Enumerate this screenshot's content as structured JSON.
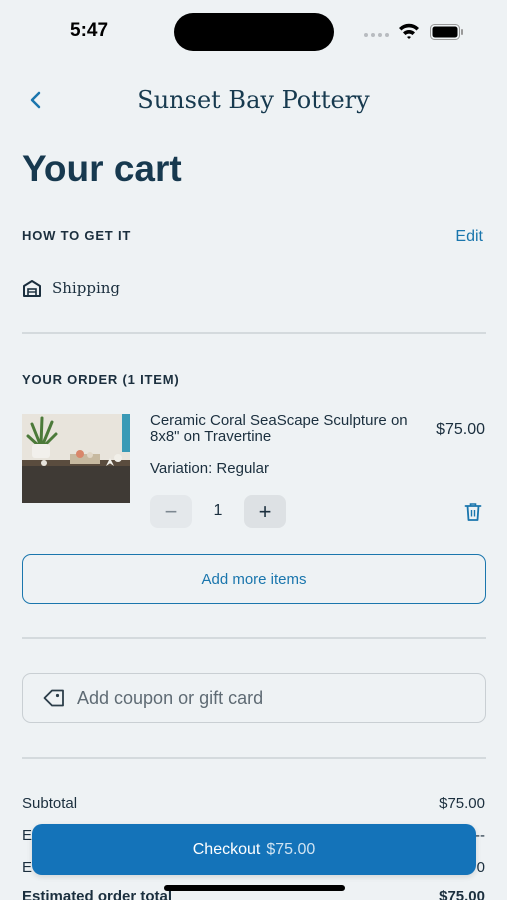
{
  "status_bar": {
    "time": "5:47"
  },
  "header": {
    "store_name": "Sunset Bay Pottery",
    "page_title": "Your cart"
  },
  "fulfillment": {
    "section_label": "HOW TO GET IT",
    "edit_label": "Edit",
    "method": "Shipping"
  },
  "order": {
    "section_label": "YOUR ORDER (1 ITEM)",
    "items": [
      {
        "name": "Ceramic Coral SeaScape Sculpture on 8x8\" on Travertine",
        "price": "$75.00",
        "variation": "Variation: Regular",
        "quantity": "1",
        "minus_label": "−",
        "plus_label": "+"
      }
    ],
    "add_more_label": "Add more items"
  },
  "coupon": {
    "placeholder": "Add coupon or gift card"
  },
  "summary": {
    "subtotal_label": "Subtotal",
    "subtotal_value": "$75.00",
    "row2_label": "E",
    "row2_value": "--",
    "row3_label": "E",
    "row3_value": "0",
    "total_label": "Estimated order total",
    "total_value": "$75.00"
  },
  "checkout": {
    "label": "Checkout",
    "amount": "$75.00"
  },
  "colors": {
    "accent": "#1a76ad",
    "checkout_bg": "#1473b9",
    "background": "#eef2f4",
    "title": "#17394f"
  }
}
